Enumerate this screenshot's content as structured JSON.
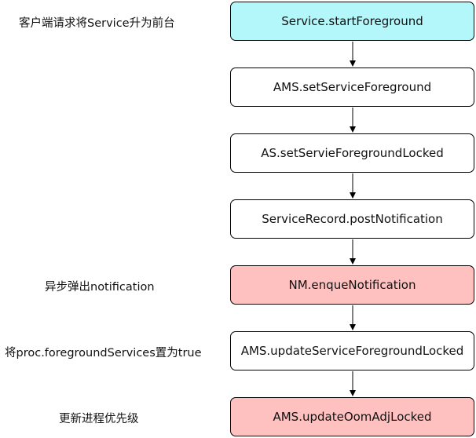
{
  "nodes": [
    {
      "label": "Service.startForeground",
      "fill": "#b3f7fb"
    },
    {
      "label": "AMS.setServiceForeground",
      "fill": "#ffffff"
    },
    {
      "label": "AS.setServieForegroundLocked",
      "fill": "#ffffff"
    },
    {
      "label": "ServiceRecord.postNotification",
      "fill": "#ffffff"
    },
    {
      "label": "NM.enqueNotification",
      "fill": "#ffc0c0"
    },
    {
      "label": "AMS.updateServiceForegroundLocked",
      "fill": "#ffffff"
    },
    {
      "label": "AMS.updateOomAdjLocked",
      "fill": "#ffc0c0"
    }
  ],
  "notes": {
    "n1": "客户端请求将Service升为前台",
    "n5": "异步弹出notification",
    "n6": "将proc.foregroundServices置为true",
    "n7": "更新进程优先级"
  }
}
